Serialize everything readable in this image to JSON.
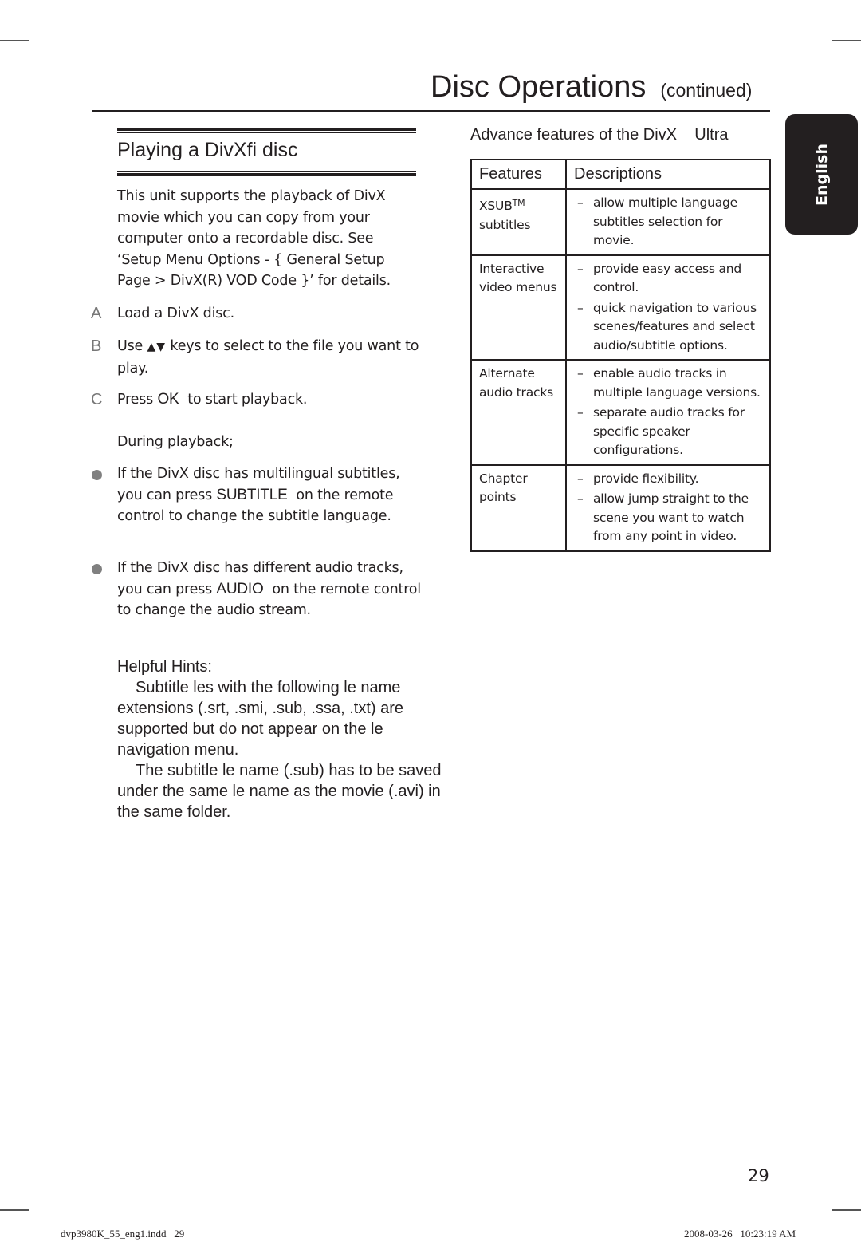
{
  "header": {
    "title": "Disc Operations",
    "continued": "(continued)"
  },
  "language_tab": "English",
  "left": {
    "section_title": "Playing a DivXfi disc",
    "intro": "This unit supports the playback of DivX movie which you can copy from your computer onto a recordable disc. See ‘Setup Menu Options - { General Setup Page > DivX(R) VOD Code }’ for details.",
    "steps": [
      {
        "marker": "A",
        "text": "Load a DivX disc."
      },
      {
        "marker": "B",
        "pre": "Use",
        "keys": "▲▼",
        "post": "keys to select to the file you want to play."
      },
      {
        "marker": "C",
        "pre": "Press",
        "key": "OK",
        "post": "to start playback."
      }
    ],
    "during": "During playback;",
    "bullets": [
      {
        "pre": "If the DivX disc has multilingual subtitles, you can press",
        "key": "SUBTITLE",
        "post": "on the remote control to change the subtitle language."
      },
      {
        "pre": "If the DivX disc has different audio tracks, you can press",
        "key": "AUDIO",
        "post": "on the remote control to change the audio stream."
      }
    ],
    "hints": {
      "title": "Helpful Hints:",
      "items": [
        "Subtitle  les with the following  le name extensions (.srt, .smi, .sub, .ssa, .txt) are supported but do not appear on the  le navigation menu.",
        "The subtitle  le name (.sub) has to be saved under the same  le name as the movie (.avi) in the same folder."
      ]
    }
  },
  "right": {
    "title": "Advance features of the DivX    Ultra",
    "table": {
      "headers": [
        "Features",
        "Descriptions"
      ],
      "rows": [
        {
          "feature": "XSUB",
          "feature_sup": "TM",
          "feature_line2": "subtitles",
          "descriptions": [
            "allow multiple language subtitles selection for movie."
          ]
        },
        {
          "feature": "Interactive video menus",
          "descriptions": [
            "provide easy access and control.",
            "quick navigation to various scenes/features and select audio/subtitle options."
          ]
        },
        {
          "feature": "Alternate audio tracks",
          "descriptions": [
            "enable audio tracks in multiple language versions.",
            "separate audio tracks for specific speaker configurations."
          ]
        },
        {
          "feature": "Chapter points",
          "descriptions": [
            "provide flexibility.",
            "allow jump straight to the scene you want to watch from any point in video."
          ]
        }
      ],
      "dash": "–"
    }
  },
  "page_number": "29",
  "footer": {
    "file": "dvp3980K_55_eng1.indd   29",
    "timestamp": "2008-03-26   10:23:19 AM"
  }
}
